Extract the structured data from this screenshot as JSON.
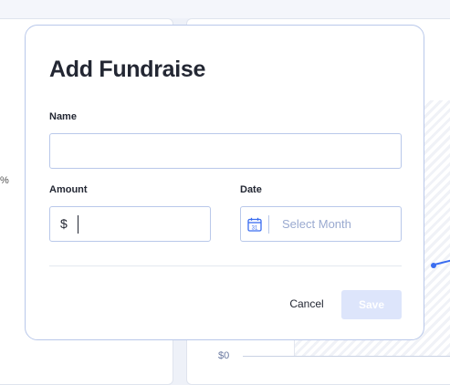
{
  "background": {
    "percent_fragment": "%",
    "axis_label": "$0"
  },
  "modal": {
    "title": "Add Fundraise",
    "name": {
      "label": "Name",
      "value": ""
    },
    "amount": {
      "label": "Amount",
      "currency_symbol": "$",
      "value": ""
    },
    "date": {
      "label": "Date",
      "placeholder": "Select Month",
      "icon": "calendar-icon",
      "calendar_day": "31"
    },
    "actions": {
      "cancel_label": "Cancel",
      "save_label": "Save"
    }
  },
  "colors": {
    "accent": "#3a6df0",
    "field_border": "#b9c8ea",
    "save_disabled_bg": "#dde5fb",
    "placeholder": "#9aaad0"
  }
}
